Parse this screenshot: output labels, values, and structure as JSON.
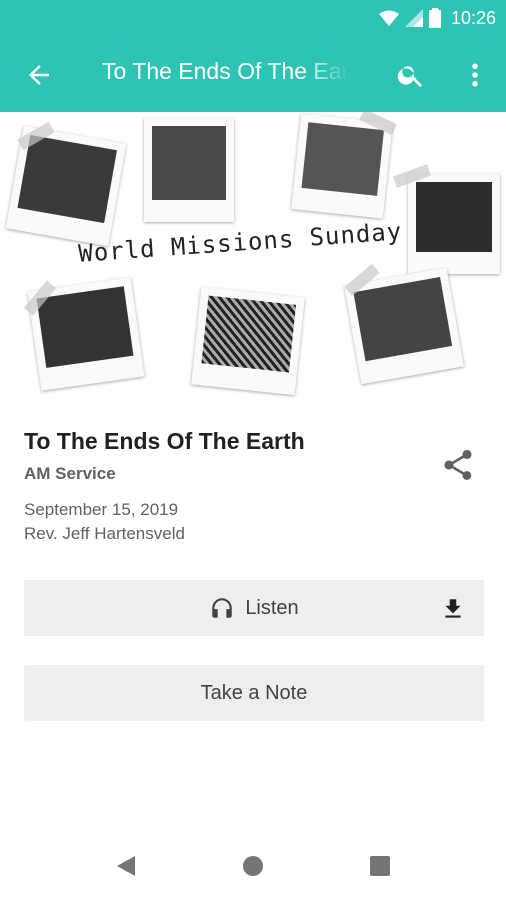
{
  "status_bar": {
    "time": "10:26"
  },
  "app_bar": {
    "title": "To The Ends Of The Earth"
  },
  "hero": {
    "caption": "World Missions Sunday"
  },
  "sermon": {
    "title": "To The Ends Of The Earth",
    "service": "AM Service",
    "date": "September 15, 2019",
    "speaker": "Rev. Jeff Hartensveld"
  },
  "actions": {
    "listen_label": "Listen",
    "note_label": "Take a Note"
  },
  "colors": {
    "accent": "#2ec4b4"
  },
  "icons": [
    "wifi-icon",
    "signal-icon",
    "battery-icon",
    "back-arrow-icon",
    "search-icon",
    "more-vert-icon",
    "share-icon",
    "headphones-icon",
    "download-icon",
    "nav-back-icon",
    "nav-home-icon",
    "nav-recent-icon"
  ]
}
